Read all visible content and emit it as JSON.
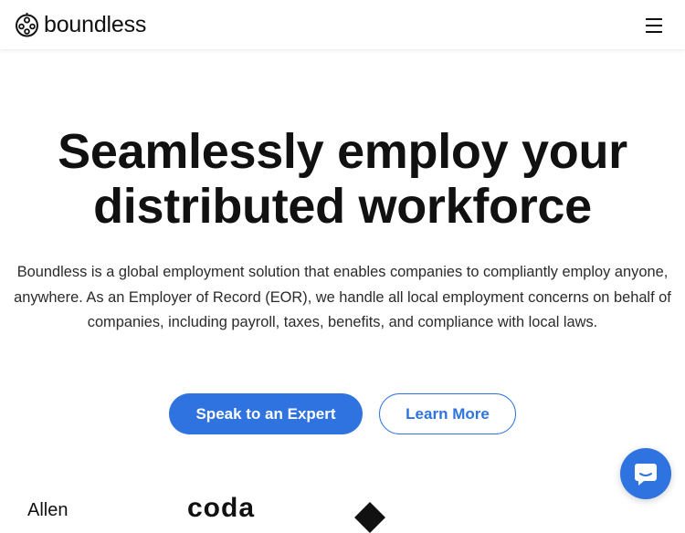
{
  "header": {
    "logo_text": "boundless",
    "menu_icon": "hamburger-menu-icon"
  },
  "hero": {
    "title_line1": "Seamlessly employ your",
    "title_line2": "distributed workforce",
    "description": "Boundless is a global employment solution that enables companies to compliantly employ anyone, anywhere. As an Employer of Record (EOR), we handle all local employment concerns on behalf of companies, including payroll, taxes, benefits, and compliance with local laws.",
    "primary_cta": "Speak to an Expert",
    "secondary_cta": "Learn More"
  },
  "clients": {
    "items": [
      "Allen",
      "coda"
    ]
  },
  "chat": {
    "icon": "chat-bubble-icon"
  },
  "colors": {
    "accent": "#2f73e0",
    "text": "#111111",
    "background": "#ffffff"
  }
}
